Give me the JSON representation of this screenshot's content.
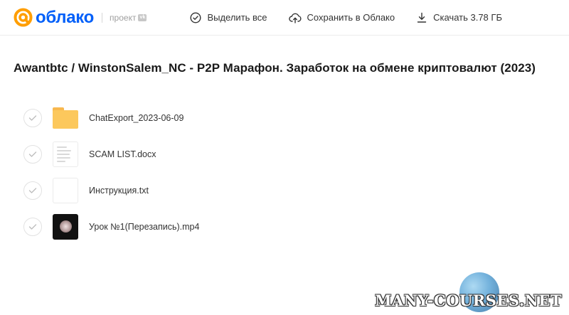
{
  "header": {
    "logo_text": "облако",
    "project_label": "проект",
    "vk_badge": "vk",
    "actions": [
      {
        "label": "Выделить все",
        "icon": "check-circle-icon"
      },
      {
        "label": "Сохранить в Облако",
        "icon": "cloud-upload-icon"
      },
      {
        "label": "Скачать 3.78 ГБ",
        "icon": "download-icon"
      }
    ]
  },
  "title": "Awantbtc / WinstonSalem_NC - P2P Марафон. Заработок на обмене криптовалют (2023)",
  "files": [
    {
      "name": "ChatExport_2023-06-09",
      "type": "folder"
    },
    {
      "name": "SCAM LIST.docx",
      "type": "docx"
    },
    {
      "name": "Инструкция.txt",
      "type": "txt"
    },
    {
      "name": "Урок №1(Перезапись).mp4",
      "type": "mp4"
    }
  ],
  "watermark": "MANY-COURSES.NET",
  "colors": {
    "brand": "#005ff9",
    "logo_accent": "#ff9e00",
    "folder": "#fcc85c"
  }
}
